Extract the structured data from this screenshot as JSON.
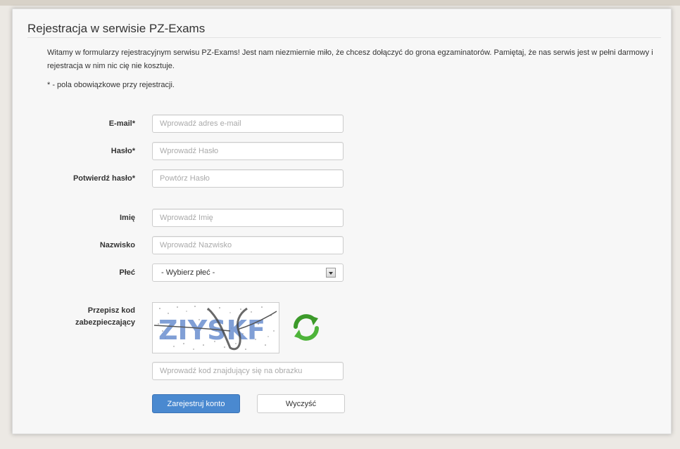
{
  "page": {
    "title": "Rejestracja w serwisie PZ-Exams",
    "intro": "Witamy w formularzy rejestracyjnym serwisu PZ-Exams! Jest nam niezmiernie miło, że chcesz dołączyć do grona egzaminatorów. Pamiętaj, że nas serwis jest w pełni darmowy i rejestracja w nim nic cię nie kosztuje.",
    "required_note": "* - pola obowiązkowe przy rejestracji."
  },
  "form": {
    "email": {
      "label": "E-mail*",
      "placeholder": "Wprowadź adres e-mail",
      "value": ""
    },
    "password": {
      "label": "Hasło*",
      "placeholder": "Wprowadź Hasło",
      "value": ""
    },
    "confirm": {
      "label": "Potwierdź hasło*",
      "placeholder": "Powtórz Hasło",
      "value": ""
    },
    "first_name": {
      "label": "Imię",
      "placeholder": "Wprowadź Imię",
      "value": ""
    },
    "last_name": {
      "label": "Nazwisko",
      "placeholder": "Wprowadź Nazwisko",
      "value": ""
    },
    "gender": {
      "label": "Płeć",
      "selected": "- Wybierz płeć -"
    },
    "captcha": {
      "label_line1": "Przepisz kod",
      "label_line2": "zabezpieczający",
      "image_text": "ZIYSKF",
      "placeholder": "Wprowadź kod znajdujący się na obrazku",
      "value": ""
    }
  },
  "buttons": {
    "register": "Zarejestruj konto",
    "clear": "Wyczyść"
  },
  "colors": {
    "primary": "#4a89d0",
    "captcha_text": "#6a8fd0",
    "refresh_green": "#3c9a2a"
  },
  "icons": {
    "refresh": "refresh-icon"
  }
}
